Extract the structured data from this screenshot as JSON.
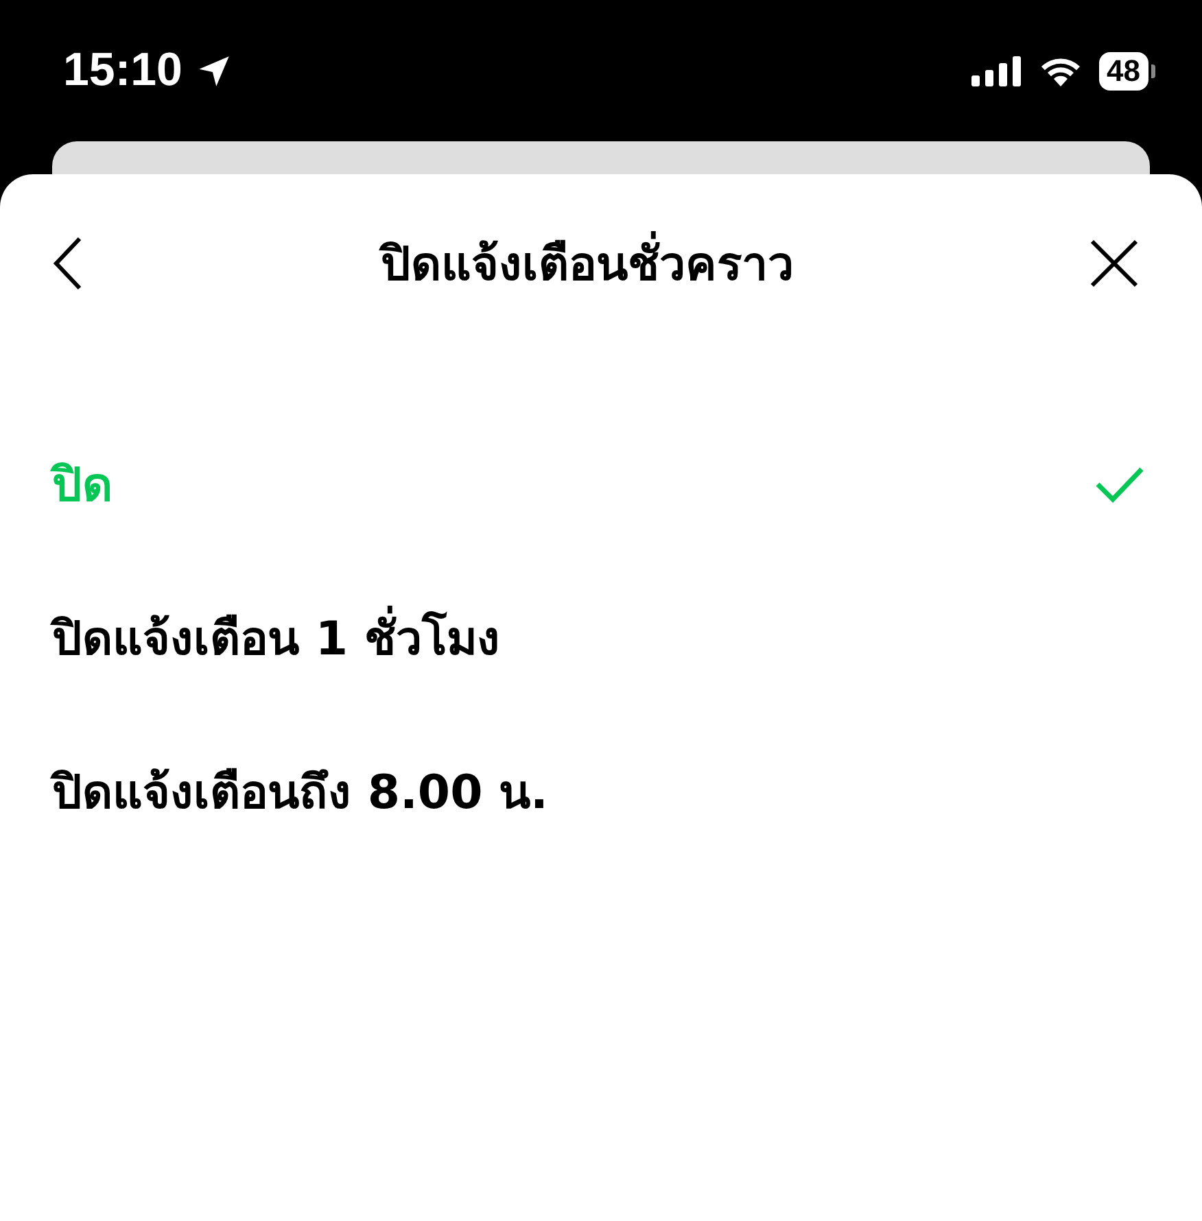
{
  "status_bar": {
    "time": "15:10",
    "battery": "48"
  },
  "header": {
    "title": "ปิดแจ้งเตือนชั่วคราว"
  },
  "options": [
    {
      "label": "ปิด",
      "selected": true
    },
    {
      "label": "ปิดแจ้งเตือน 1 ชั่วโมง",
      "selected": false
    },
    {
      "label": "ปิดแจ้งเตือนถึง 8.00 น.",
      "selected": false
    }
  ]
}
